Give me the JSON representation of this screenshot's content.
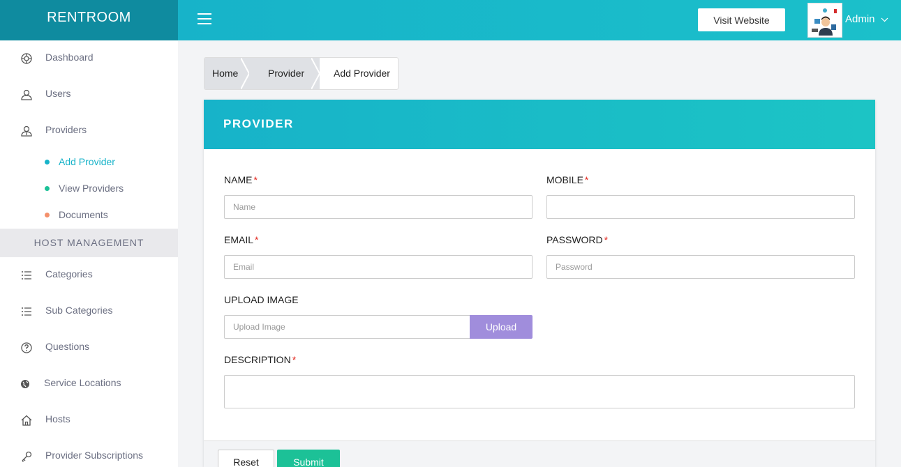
{
  "app": {
    "brand": "RENTROOM"
  },
  "topbar": {
    "visit_label": "Visit Website",
    "admin_label": "Admin"
  },
  "sidebar": {
    "items": [
      {
        "label": "Dashboard",
        "icon": "dashboard-icon"
      },
      {
        "label": "Users",
        "icon": "user-icon"
      },
      {
        "label": "Providers",
        "icon": "providers-icon"
      }
    ],
    "sub_items": [
      {
        "label": "Add Provider",
        "color": "#17b3c9",
        "active": true
      },
      {
        "label": "View Providers",
        "color": "#1cc197",
        "active": false
      },
      {
        "label": "Documents",
        "color": "#f4906b",
        "active": false
      }
    ],
    "section_header": "HOST MANAGEMENT",
    "host_items": [
      {
        "label": "Categories",
        "icon": "list-icon"
      },
      {
        "label": "Sub Categories",
        "icon": "list-icon"
      },
      {
        "label": "Questions",
        "icon": "question-icon"
      },
      {
        "label": "Service Locations",
        "icon": "globe-icon"
      },
      {
        "label": "Hosts",
        "icon": "home-icon"
      },
      {
        "label": "Provider Subscriptions",
        "icon": "key-icon"
      }
    ]
  },
  "breadcrumb": {
    "items": [
      "Home",
      "Provider",
      "Add Provider"
    ]
  },
  "form": {
    "title": "PROVIDER",
    "name_label": "NAME",
    "name_placeholder": "Name",
    "mobile_label": "MOBILE",
    "mobile_placeholder": "",
    "email_label": "EMAIL",
    "email_placeholder": "Email",
    "password_label": "PASSWORD",
    "password_placeholder": "Password",
    "upload_label": "UPLOAD IMAGE",
    "upload_placeholder": "Upload Image",
    "upload_button": "Upload",
    "description_label": "DESCRIPTION",
    "required_mark": "*",
    "reset_label": "Reset",
    "submit_label": "Submit"
  },
  "colors": {
    "accent": "#17b3c9",
    "brand_bg": "#0f8b9f",
    "upload_btn": "#a08ddc",
    "submit_btn": "#1cc197",
    "required": "#e2231a"
  }
}
